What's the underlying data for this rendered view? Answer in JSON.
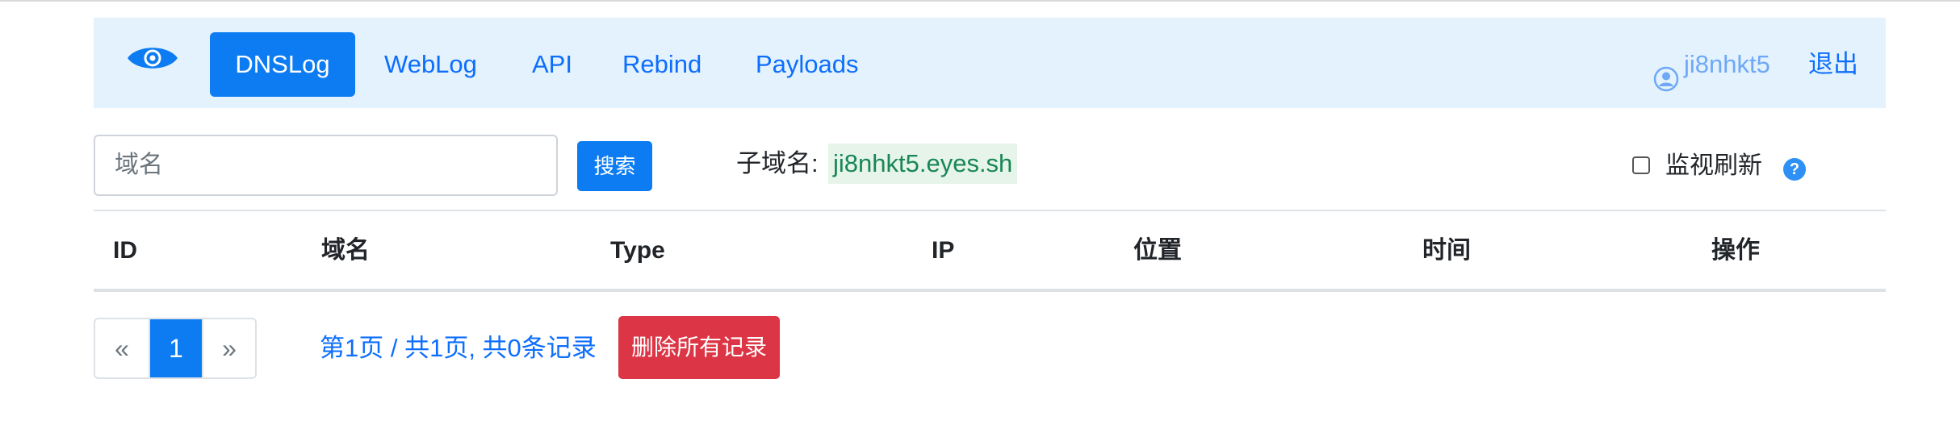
{
  "navbar": {
    "brand_icon": "eye-icon",
    "items": [
      {
        "label": "DNSLog",
        "active": true
      },
      {
        "label": "WebLog",
        "active": false
      },
      {
        "label": "API",
        "active": false
      },
      {
        "label": "Rebind",
        "active": false
      },
      {
        "label": "Payloads",
        "active": false
      }
    ],
    "user": {
      "icon": "user-circle-icon",
      "name": "ji8nhkt5"
    },
    "logout_label": "退出"
  },
  "search": {
    "placeholder": "域名",
    "value": "",
    "button_label": "搜索"
  },
  "subdomain": {
    "label": "子域名:",
    "value": "ji8nhkt5.eyes.sh"
  },
  "monitor": {
    "checked": false,
    "label": "监视刷新",
    "help_glyph": "?"
  },
  "table": {
    "columns": [
      "ID",
      "域名",
      "Type",
      "IP",
      "位置",
      "时间",
      "操作"
    ],
    "rows": []
  },
  "pagination": {
    "prev": "«",
    "current": "1",
    "next": "»",
    "info": "第1页 / 共1页, 共0条记录"
  },
  "delete_all_label": "删除所有记录",
  "colors": {
    "primary": "#0d7cf2",
    "navbar_bg": "#e3f2fd",
    "danger": "#dc3545",
    "success_text": "#198754"
  }
}
